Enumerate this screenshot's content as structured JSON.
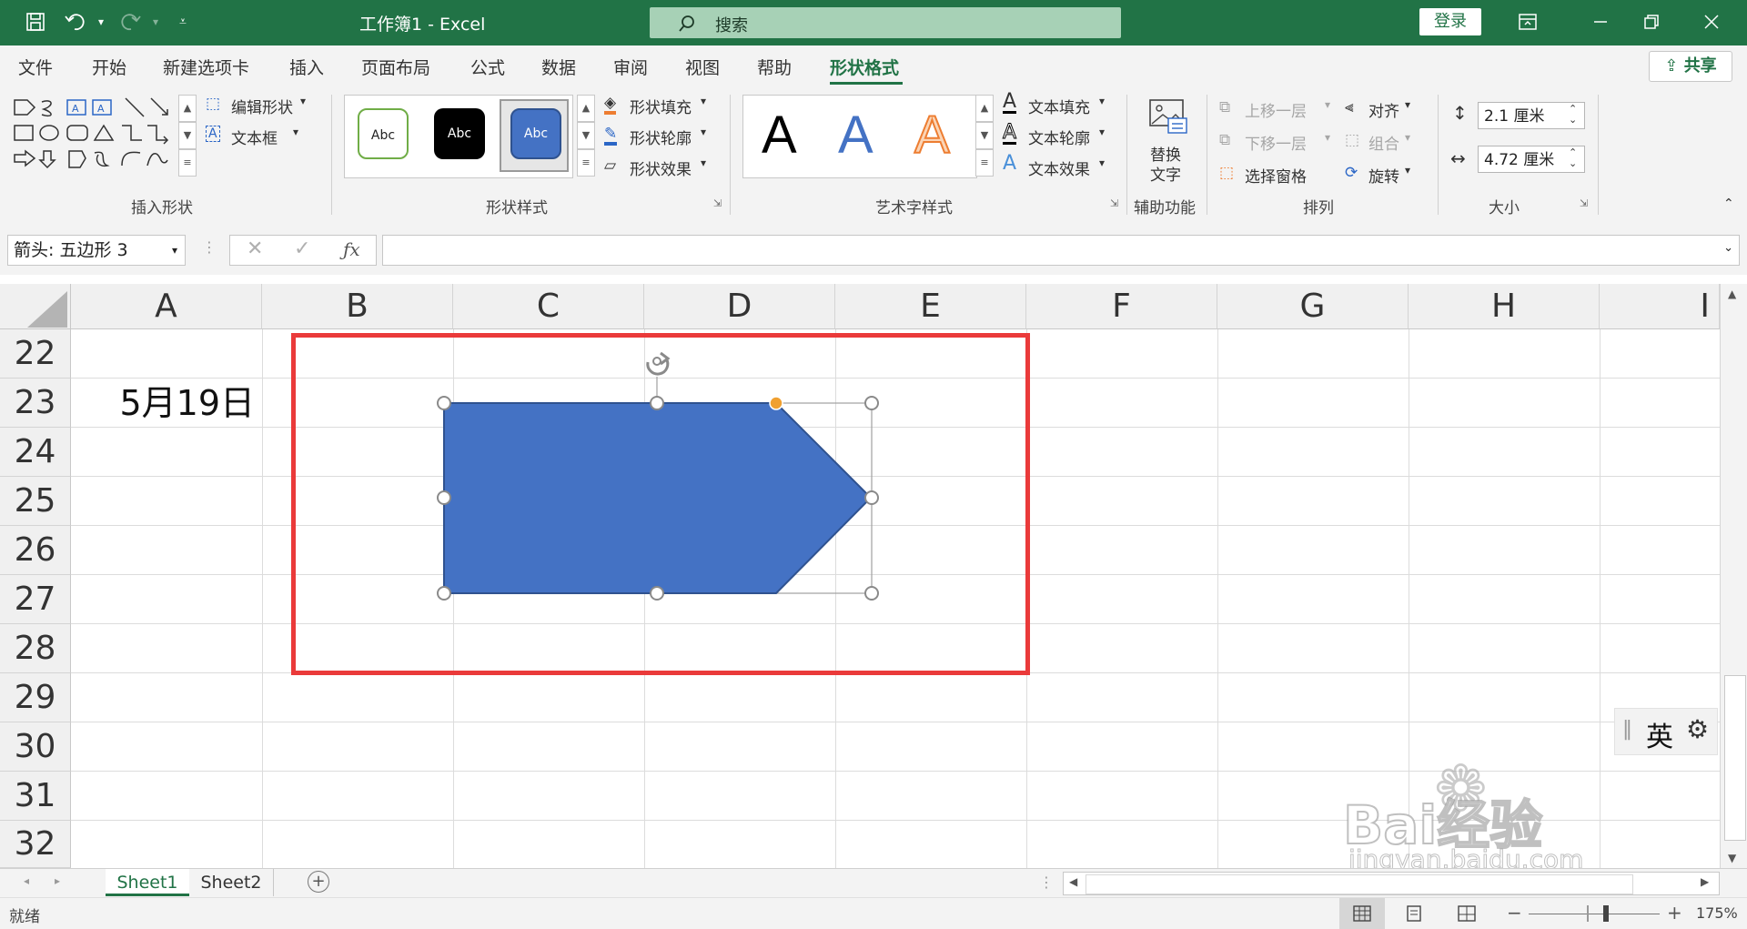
{
  "titlebar": {
    "title": "工作簿1  -  Excel",
    "search_placeholder": "搜索",
    "login_label": "登录"
  },
  "menu": {
    "tabs": [
      "文件",
      "开始",
      "新建选项卡",
      "插入",
      "页面布局",
      "公式",
      "数据",
      "审阅",
      "视图",
      "帮助",
      "形状格式"
    ],
    "active_tab": "形状格式",
    "share_label": "共享"
  },
  "ribbon": {
    "insert_shapes": {
      "label": "插入形状",
      "edit_shape": "编辑形状",
      "text_box": "文本框"
    },
    "shape_styles": {
      "label": "形状样式",
      "thumbs": [
        "Abc",
        "Abc",
        "Abc"
      ],
      "fill": "形状填充",
      "outline": "形状轮廓",
      "effects": "形状效果"
    },
    "wordart": {
      "label": "艺术字样式",
      "letters": [
        "A",
        "A",
        "A"
      ],
      "text_fill": "文本填充",
      "text_outline": "文本轮廓",
      "text_effects": "文本效果"
    },
    "accessibility": {
      "label": "辅助功能",
      "alt_text_line1": "替换",
      "alt_text_line2": "文字"
    },
    "arrange": {
      "label": "排列",
      "bring_forward": "上移一层",
      "send_backward": "下移一层",
      "selection_pane": "选择窗格",
      "align": "对齐",
      "group": "组合",
      "rotate": "旋转"
    },
    "size": {
      "label": "大小",
      "height": "2.1 厘米",
      "width": "4.72 厘米"
    }
  },
  "formula_bar": {
    "name_box": "箭头: 五边形 3",
    "formula": ""
  },
  "grid": {
    "columns": [
      "A",
      "B",
      "C",
      "D",
      "E",
      "F",
      "G",
      "H",
      "I"
    ],
    "rows": [
      "22",
      "23",
      "24",
      "25",
      "26",
      "27",
      "28",
      "29",
      "30",
      "31",
      "32"
    ],
    "cell_A23": "5月19日"
  },
  "ime": {
    "mode": "英"
  },
  "sheets": {
    "tabs": [
      "Sheet1",
      "Sheet2"
    ],
    "active": "Sheet1"
  },
  "status": {
    "ready": "就绪",
    "zoom": "175%"
  },
  "watermark": {
    "text1": "Bai经验",
    "text2": "jingyan.baidu.com"
  },
  "colors": {
    "excel_green": "#217346",
    "shape_fill": "#4472c4",
    "highlight_red": "#ea3a3a",
    "adjust_handle": "#f0a030"
  }
}
